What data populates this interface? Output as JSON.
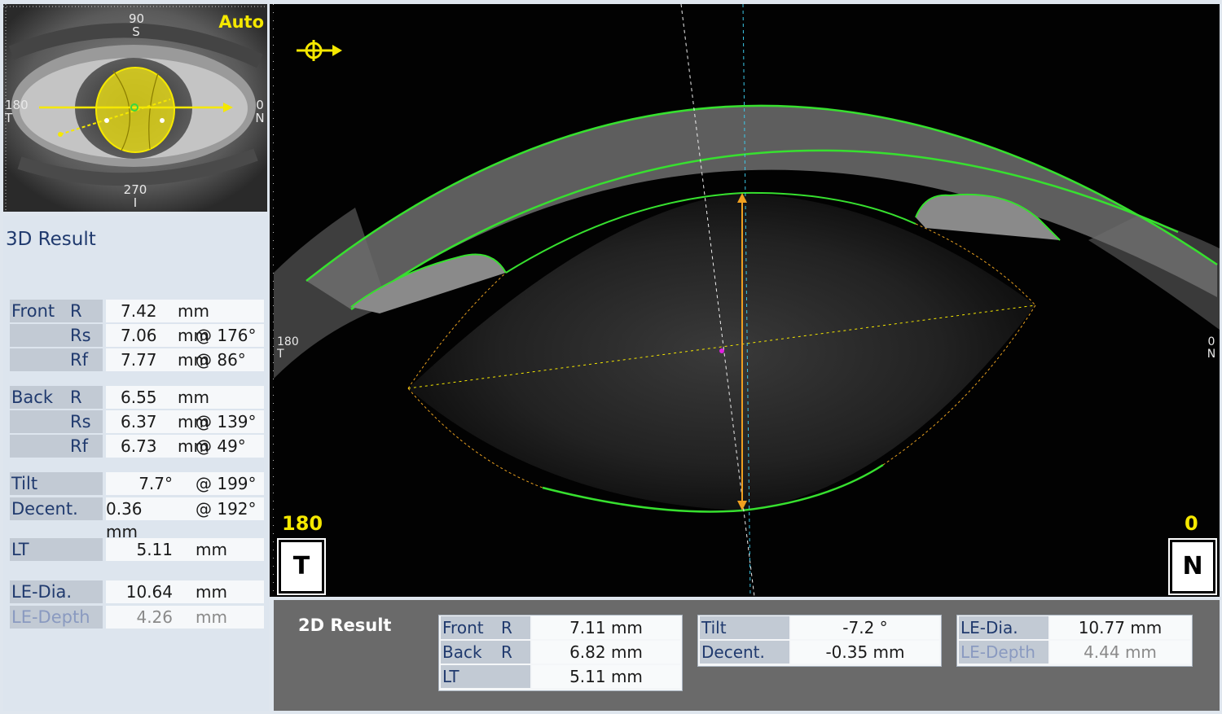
{
  "eye_view": {
    "mode_label": "Auto",
    "labels": {
      "top_deg": "90",
      "top_dir": "S",
      "left_deg": "180",
      "left_dir": "T",
      "right_deg": "0",
      "right_dir": "N",
      "bottom_deg": "270",
      "bottom_dir": "I"
    }
  },
  "result_3d": {
    "title": "3D Result",
    "front": [
      {
        "group": "Front",
        "param": "R",
        "value": "7.42",
        "unit": "mm",
        "angle": ""
      },
      {
        "group": "",
        "param": "Rs",
        "value": "7.06",
        "unit": "mm",
        "angle": "@ 176°"
      },
      {
        "group": "",
        "param": "Rf",
        "value": "7.77",
        "unit": "mm",
        "angle": "@ 86°"
      }
    ],
    "back": [
      {
        "group": "Back",
        "param": "R",
        "value": "6.55",
        "unit": "mm",
        "angle": ""
      },
      {
        "group": "",
        "param": "Rs",
        "value": "6.37",
        "unit": "mm",
        "angle": "@ 139°"
      },
      {
        "group": "",
        "param": "Rf",
        "value": "6.73",
        "unit": "mm",
        "angle": "@ 49°"
      }
    ],
    "tilt": {
      "label": "Tilt",
      "value": "7.7°",
      "angle": "@ 199°"
    },
    "decent": {
      "label": "Decent.",
      "value": "0.36 mm",
      "angle": "@ 192°"
    },
    "lt": {
      "label": "LT",
      "value": "5.11",
      "unit": "mm"
    },
    "le_dia": {
      "label": "LE-Dia.",
      "value": "10.64",
      "unit": "mm"
    },
    "le_depth": {
      "label": "LE-Depth",
      "value": "4.26",
      "unit": "mm"
    }
  },
  "oct_view": {
    "left_corner": "180",
    "right_corner": "0",
    "left_dir": "T",
    "right_dir": "N",
    "left_side_deg": "180",
    "left_side_dir": "T",
    "right_side_deg": "0",
    "right_side_dir": "N"
  },
  "result_2d": {
    "title": "2D Result",
    "front_r": {
      "group": "Front",
      "param": "R",
      "value": "7.11 mm"
    },
    "back_r": {
      "group": "Back",
      "param": "R",
      "value": "6.82 mm"
    },
    "lt": {
      "label": "LT",
      "value": "5.11 mm"
    },
    "tilt": {
      "label": "Tilt",
      "value": "-7.2 °"
    },
    "decent": {
      "label": "Decent.",
      "value": "-0.35 mm"
    },
    "le_dia": {
      "label": "LE-Dia.",
      "value": "10.77 mm"
    },
    "le_depth": {
      "label": "LE-Depth",
      "value": "4.44 mm"
    }
  },
  "colors": {
    "accent_yellow": "#f5e800",
    "contour_green": "#37e02f",
    "label_blue": "#203a6e",
    "label_bg": "#c2cad4"
  }
}
